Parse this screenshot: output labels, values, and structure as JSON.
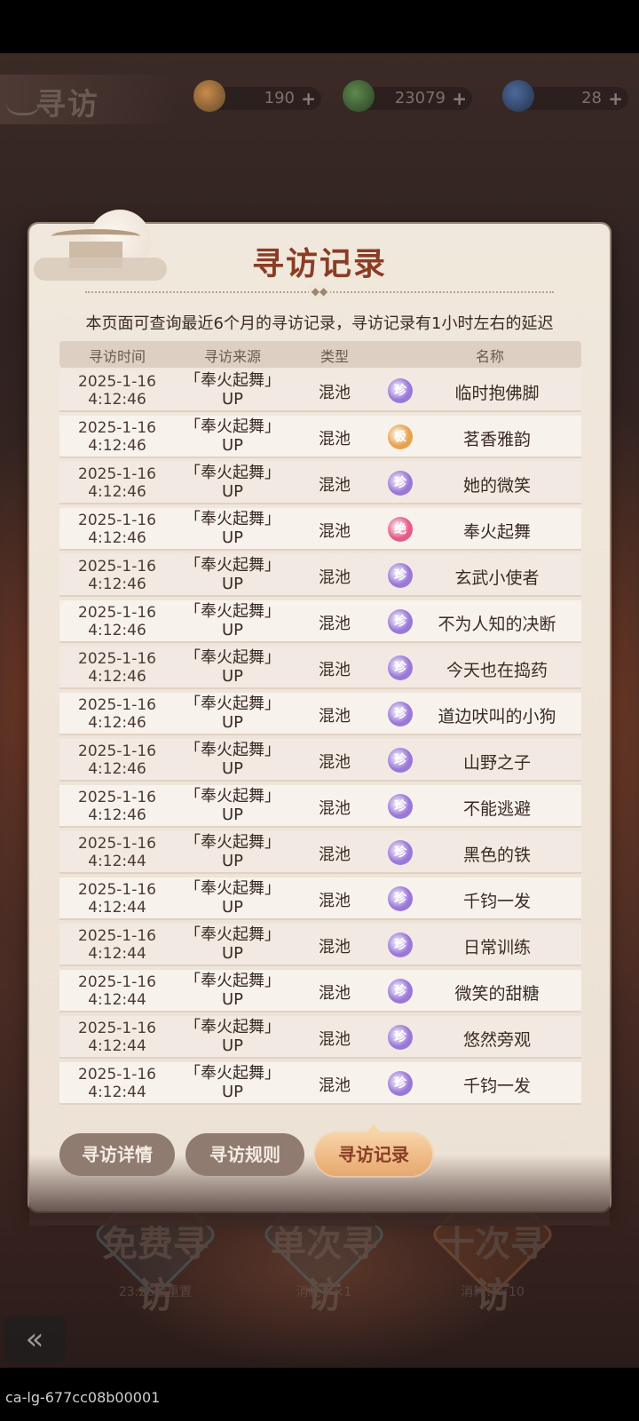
{
  "header": {
    "title": "寻访"
  },
  "resources": [
    {
      "icon": "peach-coin-icon",
      "value": "190"
    },
    {
      "icon": "jade-coin-icon",
      "value": "23079"
    },
    {
      "icon": "feather-ticket-icon",
      "value": "28"
    }
  ],
  "plus": "+",
  "modal": {
    "title": "寻访记录",
    "notice": "本页面可查询最近6个月的寻访记录，寻访记录有1小时左右的延迟",
    "columns": {
      "time": "寻访时间",
      "source": "寻访来源",
      "type": "类型",
      "name": "名称"
    },
    "rows": [
      {
        "date": "2025-1-16",
        "time": "4:12:46",
        "src1": "「奉火起舞」",
        "src2": "UP",
        "type": "混池",
        "rarity": "珍",
        "rarity_color": "#9a78d8",
        "name": "临时抱佛脚"
      },
      {
        "date": "2025-1-16",
        "time": "4:12:46",
        "src1": "「奉火起舞」",
        "src2": "UP",
        "type": "混池",
        "rarity": "极",
        "rarity_color": "#e8a24e",
        "name": "茗香雅韵"
      },
      {
        "date": "2025-1-16",
        "time": "4:12:46",
        "src1": "「奉火起舞」",
        "src2": "UP",
        "type": "混池",
        "rarity": "珍",
        "rarity_color": "#9a78d8",
        "name": "她的微笑"
      },
      {
        "date": "2025-1-16",
        "time": "4:12:46",
        "src1": "「奉火起舞」",
        "src2": "UP",
        "type": "混池",
        "rarity": "绝",
        "rarity_color": "#e65a8a",
        "name": "奉火起舞"
      },
      {
        "date": "2025-1-16",
        "time": "4:12:46",
        "src1": "「奉火起舞」",
        "src2": "UP",
        "type": "混池",
        "rarity": "珍",
        "rarity_color": "#9a78d8",
        "name": "玄武小使者"
      },
      {
        "date": "2025-1-16",
        "time": "4:12:46",
        "src1": "「奉火起舞」",
        "src2": "UP",
        "type": "混池",
        "rarity": "珍",
        "rarity_color": "#9a78d8",
        "name": "不为人知的决断"
      },
      {
        "date": "2025-1-16",
        "time": "4:12:46",
        "src1": "「奉火起舞」",
        "src2": "UP",
        "type": "混池",
        "rarity": "珍",
        "rarity_color": "#9a78d8",
        "name": "今天也在捣药"
      },
      {
        "date": "2025-1-16",
        "time": "4:12:46",
        "src1": "「奉火起舞」",
        "src2": "UP",
        "type": "混池",
        "rarity": "珍",
        "rarity_color": "#9a78d8",
        "name": "道边吠叫的小狗"
      },
      {
        "date": "2025-1-16",
        "time": "4:12:46",
        "src1": "「奉火起舞」",
        "src2": "UP",
        "type": "混池",
        "rarity": "珍",
        "rarity_color": "#9a78d8",
        "name": "山野之子"
      },
      {
        "date": "2025-1-16",
        "time": "4:12:46",
        "src1": "「奉火起舞」",
        "src2": "UP",
        "type": "混池",
        "rarity": "珍",
        "rarity_color": "#9a78d8",
        "name": "不能逃避"
      },
      {
        "date": "2025-1-16",
        "time": "4:12:44",
        "src1": "「奉火起舞」",
        "src2": "UP",
        "type": "混池",
        "rarity": "珍",
        "rarity_color": "#9a78d8",
        "name": "黑色的铁"
      },
      {
        "date": "2025-1-16",
        "time": "4:12:44",
        "src1": "「奉火起舞」",
        "src2": "UP",
        "type": "混池",
        "rarity": "珍",
        "rarity_color": "#9a78d8",
        "name": "千钧一发"
      },
      {
        "date": "2025-1-16",
        "time": "4:12:44",
        "src1": "「奉火起舞」",
        "src2": "UP",
        "type": "混池",
        "rarity": "珍",
        "rarity_color": "#9a78d8",
        "name": "日常训练"
      },
      {
        "date": "2025-1-16",
        "time": "4:12:44",
        "src1": "「奉火起舞」",
        "src2": "UP",
        "type": "混池",
        "rarity": "珍",
        "rarity_color": "#9a78d8",
        "name": "微笑的甜糖"
      },
      {
        "date": "2025-1-16",
        "time": "4:12:44",
        "src1": "「奉火起舞」",
        "src2": "UP",
        "type": "混池",
        "rarity": "珍",
        "rarity_color": "#9a78d8",
        "name": "悠然旁观"
      },
      {
        "date": "2025-1-16",
        "time": "4:12:44",
        "src1": "「奉火起舞」",
        "src2": "UP",
        "type": "混池",
        "rarity": "珍",
        "rarity_color": "#9a78d8",
        "name": "千钧一发"
      }
    ]
  },
  "tabs": [
    {
      "label": "寻访详情",
      "active": false
    },
    {
      "label": "寻访规则",
      "active": false
    },
    {
      "label": "寻访记录",
      "active": true
    }
  ],
  "ghost_buttons": [
    {
      "label": "免费寻访",
      "sub": "23:26后重置"
    },
    {
      "label": "单次寻访",
      "sub": "消耗：×1"
    },
    {
      "label": "十次寻访",
      "sub": "消耗：×10"
    }
  ],
  "footer_id": "ca-lg-677cc08b00001",
  "colors": {
    "title": "#8a3d25",
    "panel": "#f1e8dd",
    "active_tab": "#e7a86e"
  }
}
